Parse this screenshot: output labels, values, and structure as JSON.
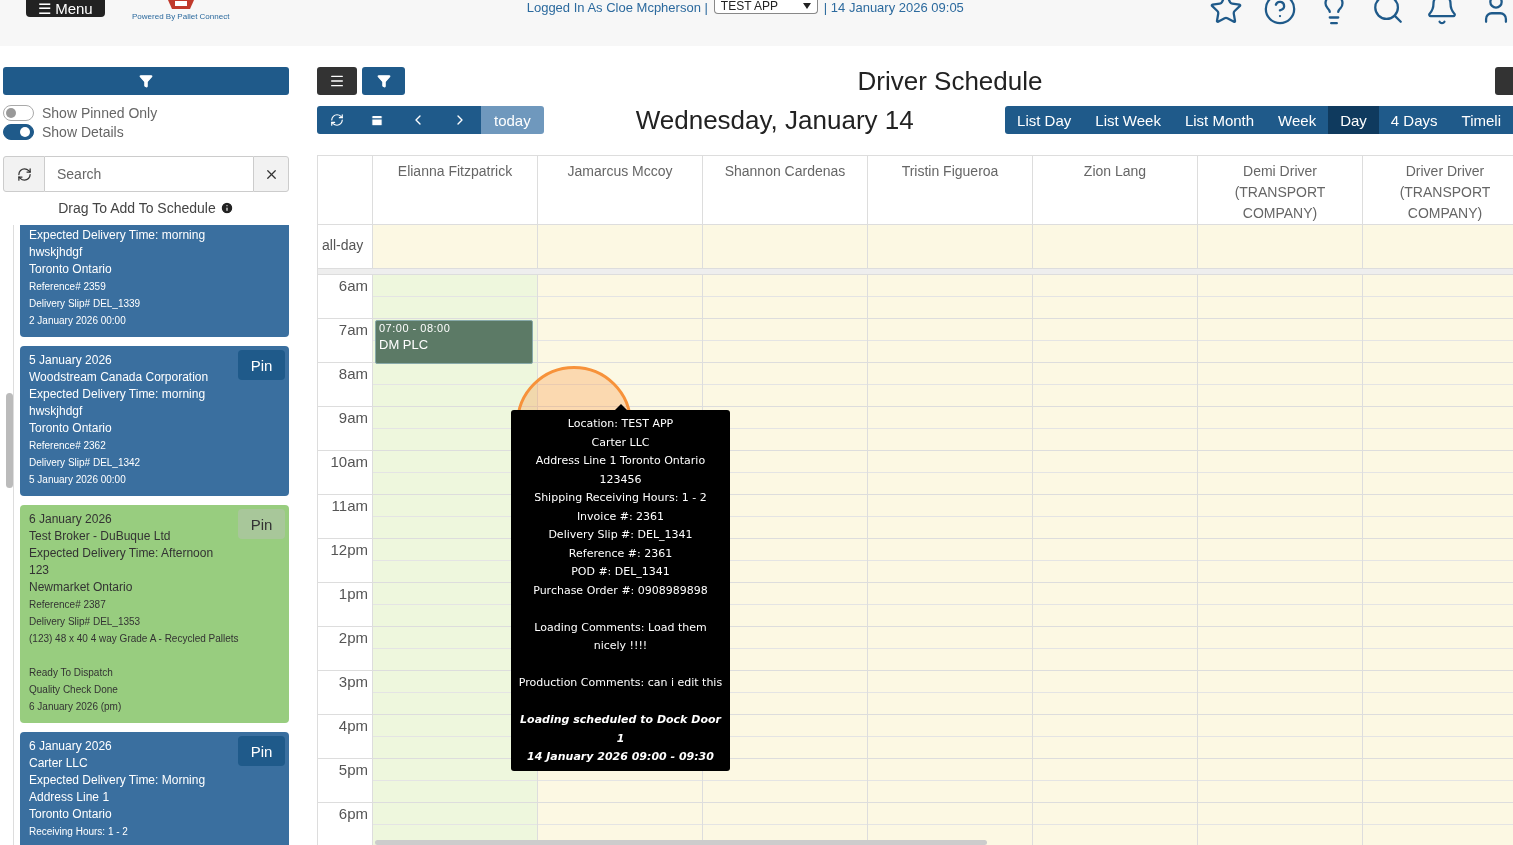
{
  "header": {
    "menu_button": "☰ Menu",
    "logo_caption": "Powered By Pallet Connect",
    "logged_in": "Logged In As Cloe Mcpherson |",
    "company_select": "TEST APP",
    "date_time": "| 14 January 2026 09:05"
  },
  "sidebar": {
    "toggles": [
      {
        "label": "Show Pinned Only",
        "on": false
      },
      {
        "label": "Show Details",
        "on": true
      }
    ],
    "search": {
      "placeholder": "Search"
    },
    "drag_hint": "Drag To Add To Schedule",
    "cards": [
      {
        "color": "#3a6f9f",
        "lines": [
          {
            "text": "Expected Delivery Time: morning",
            "kind": "main"
          },
          {
            "text": "hwskjhdgf",
            "kind": "main"
          },
          {
            "text": "Toronto Ontario",
            "kind": "main"
          },
          {
            "text": "Reference# 2359",
            "kind": "detail"
          },
          {
            "text": "Delivery Slip# DEL_1339",
            "kind": "detail"
          },
          {
            "text": "2 January 2026 00:00",
            "kind": "detail"
          }
        ]
      },
      {
        "color": "#3a6f9f",
        "pin": "Pin",
        "lines": [
          {
            "text": "5 January 2026",
            "kind": "main"
          },
          {
            "text": "Woodstream Canada Corporation",
            "kind": "main"
          },
          {
            "text": "Expected Delivery Time: morning",
            "kind": "main"
          },
          {
            "text": "hwskjhdgf",
            "kind": "main"
          },
          {
            "text": "Toronto Ontario",
            "kind": "main"
          },
          {
            "text": "Reference# 2362",
            "kind": "detail"
          },
          {
            "text": "Delivery Slip# DEL_1342",
            "kind": "detail"
          },
          {
            "text": "5 January 2026 00:00",
            "kind": "detail"
          }
        ]
      },
      {
        "color": "#98cd7f",
        "pin": "Pin",
        "lines": [
          {
            "text": "6 January 2026",
            "kind": "main"
          },
          {
            "text": "Test Broker - DuBuque Ltd",
            "kind": "main"
          },
          {
            "text": "Expected Delivery Time: Afternoon",
            "kind": "main"
          },
          {
            "text": "123",
            "kind": "main"
          },
          {
            "text": "Newmarket Ontario",
            "kind": "main"
          },
          {
            "text": "Reference# 2387",
            "kind": "detail"
          },
          {
            "text": "Delivery Slip# DEL_1353",
            "kind": "detail"
          },
          {
            "text": "(123) 48 x 40 4 way Grade A - Recycled Pallets",
            "kind": "detail"
          }
        ],
        "notes": [
          "Ready To Dispatch",
          "Quality Check Done",
          "6 January 2026 (pm)"
        ]
      },
      {
        "color": "#3a6f9f",
        "pin": "Pin",
        "lines": [
          {
            "text": "6 January 2026",
            "kind": "main"
          },
          {
            "text": "Carter LLC",
            "kind": "main"
          },
          {
            "text": "Expected Delivery Time: Morning",
            "kind": "main"
          },
          {
            "text": "Address Line 1",
            "kind": "main"
          },
          {
            "text": "Toronto Ontario",
            "kind": "main"
          },
          {
            "text": "Receiving Hours: 1 - 2",
            "kind": "detail"
          }
        ]
      }
    ]
  },
  "toolbar": {
    "title": "Driver Schedule",
    "today_button": "today",
    "date_title": "Wednesday, January 14",
    "views": [
      {
        "label": "List Day",
        "selected": false
      },
      {
        "label": "List Week",
        "selected": false
      },
      {
        "label": "List Month",
        "selected": false
      },
      {
        "label": "Week",
        "selected": false
      },
      {
        "label": "Day",
        "selected": true
      },
      {
        "label": "4 Days",
        "selected": false
      },
      {
        "label": "Timeli",
        "selected": false
      }
    ]
  },
  "calendar": {
    "all_day_label": "all-day",
    "columns": [
      {
        "name": "Elianna Fitzpatrick",
        "highlighted": true,
        "events": [
          {
            "time": "07:00 - 08:00",
            "title": "DM PLC"
          }
        ]
      },
      {
        "name": "Jamarcus Mccoy",
        "highlighted": false
      },
      {
        "name": "Shannon Cardenas",
        "highlighted": false
      },
      {
        "name": "Tristin Figueroa",
        "highlighted": false
      },
      {
        "name": "Zion Lang",
        "highlighted": false
      },
      {
        "name": "Demi Driver (TRANSPORT COMPANY)",
        "highlighted": false
      },
      {
        "name": "Driver Driver (TRANSPORT COMPANY)",
        "highlighted": false
      }
    ],
    "hours": [
      "6am",
      "7am",
      "8am",
      "9am",
      "10am",
      "11am",
      "12pm",
      "1pm",
      "2pm",
      "3pm",
      "4pm",
      "5pm",
      "6pm"
    ]
  },
  "tooltip": {
    "sections": [
      [
        "Location: TEST APP",
        "Carter LLC",
        "Address Line 1 Toronto Ontario 123456",
        "Shipping Receiving Hours: 1 - 2",
        "Invoice #: 2361",
        "Delivery Slip #: DEL_1341",
        "Reference #: 2361",
        "POD #: DEL_1341",
        "Purchase Order #: 0908989898"
      ],
      [
        "Loading Comments: Load them nicely !!!!"
      ],
      [
        "Production Comments: can i edit this"
      ]
    ],
    "footer": [
      "Loading scheduled to Dock Door 1",
      "14 January 2026 09:00 - 09:30"
    ]
  }
}
